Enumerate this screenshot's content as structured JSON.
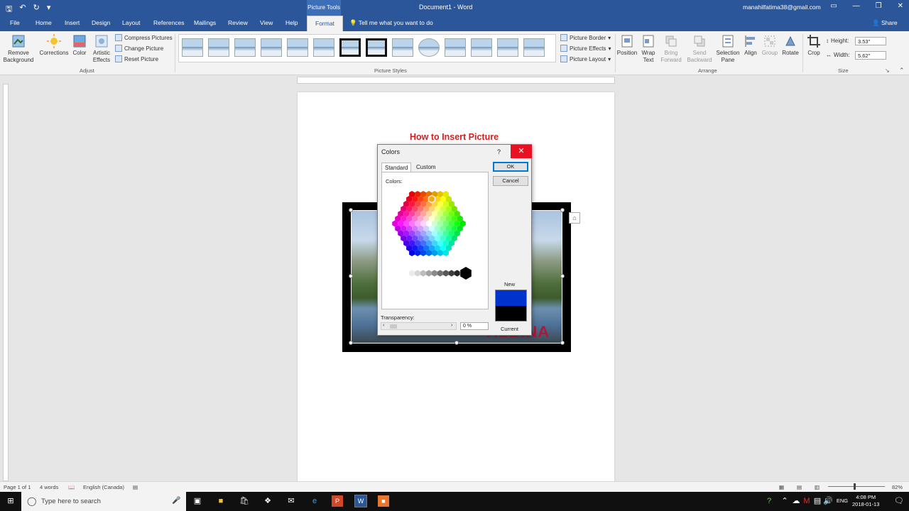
{
  "titlebar": {
    "context_tab": "Picture Tools",
    "document_title": "Document1  -  Word",
    "account": "manahilfatima38@gmail.com"
  },
  "tabs": {
    "file": "File",
    "home": "Home",
    "insert": "Insert",
    "design": "Design",
    "layout": "Layout",
    "references": "References",
    "mailings": "Mailings",
    "review": "Review",
    "view": "View",
    "help": "Help",
    "format": "Format",
    "tell_me": "Tell me what you want to do",
    "share": "Share"
  },
  "ribbon": {
    "remove_background": [
      "Remove",
      "Background"
    ],
    "corrections": "Corrections",
    "color": "Color",
    "artistic_effects": [
      "Artistic",
      "Effects"
    ],
    "compress_pictures": "Compress Pictures",
    "change_picture": "Change Picture",
    "reset_picture": "Reset Picture",
    "adjust_label": "Adjust",
    "picture_styles_label": "Picture Styles",
    "picture_border": "Picture Border",
    "picture_effects": "Picture Effects",
    "picture_layout": "Picture Layout",
    "position": "Position",
    "wrap_text": [
      "Wrap",
      "Text"
    ],
    "bring_forward": [
      "Bring",
      "Forward"
    ],
    "send_backward": [
      "Send",
      "Backward"
    ],
    "selection_pane": [
      "Selection",
      "Pane"
    ],
    "align": "Align",
    "group": "Group",
    "rotate": "Rotate",
    "arrange_label": "Arrange",
    "crop": "Crop",
    "height_label": "Height:",
    "height_value": "3.53\"",
    "width_label": "Width:",
    "width_value": "5.62\"",
    "size_label": "Size"
  },
  "document": {
    "heading": "How to Insert Picture",
    "heading_color": "#d31f1f",
    "picture_watermark": "ALBINA"
  },
  "dialog": {
    "title": "Colors",
    "help": "?",
    "close": "✕",
    "tab_standard": "Standard",
    "tab_custom": "Custom",
    "colors_label": "Colors:",
    "ok": "OK",
    "cancel": "Cancel",
    "transparency_label": "Transparency:",
    "transparency_value": "0 %",
    "new_label": "New",
    "current_label": "Current",
    "new_color": "#0033cc",
    "current_color": "#000000"
  },
  "statusbar": {
    "page": "Page 1 of 1",
    "words": "4 words",
    "language": "English (Canada)",
    "zoom": "82%"
  },
  "taskbar": {
    "search_placeholder": "Type here to search",
    "time": "4:08 PM",
    "date": "2018-01-13",
    "lang": "ENG"
  }
}
